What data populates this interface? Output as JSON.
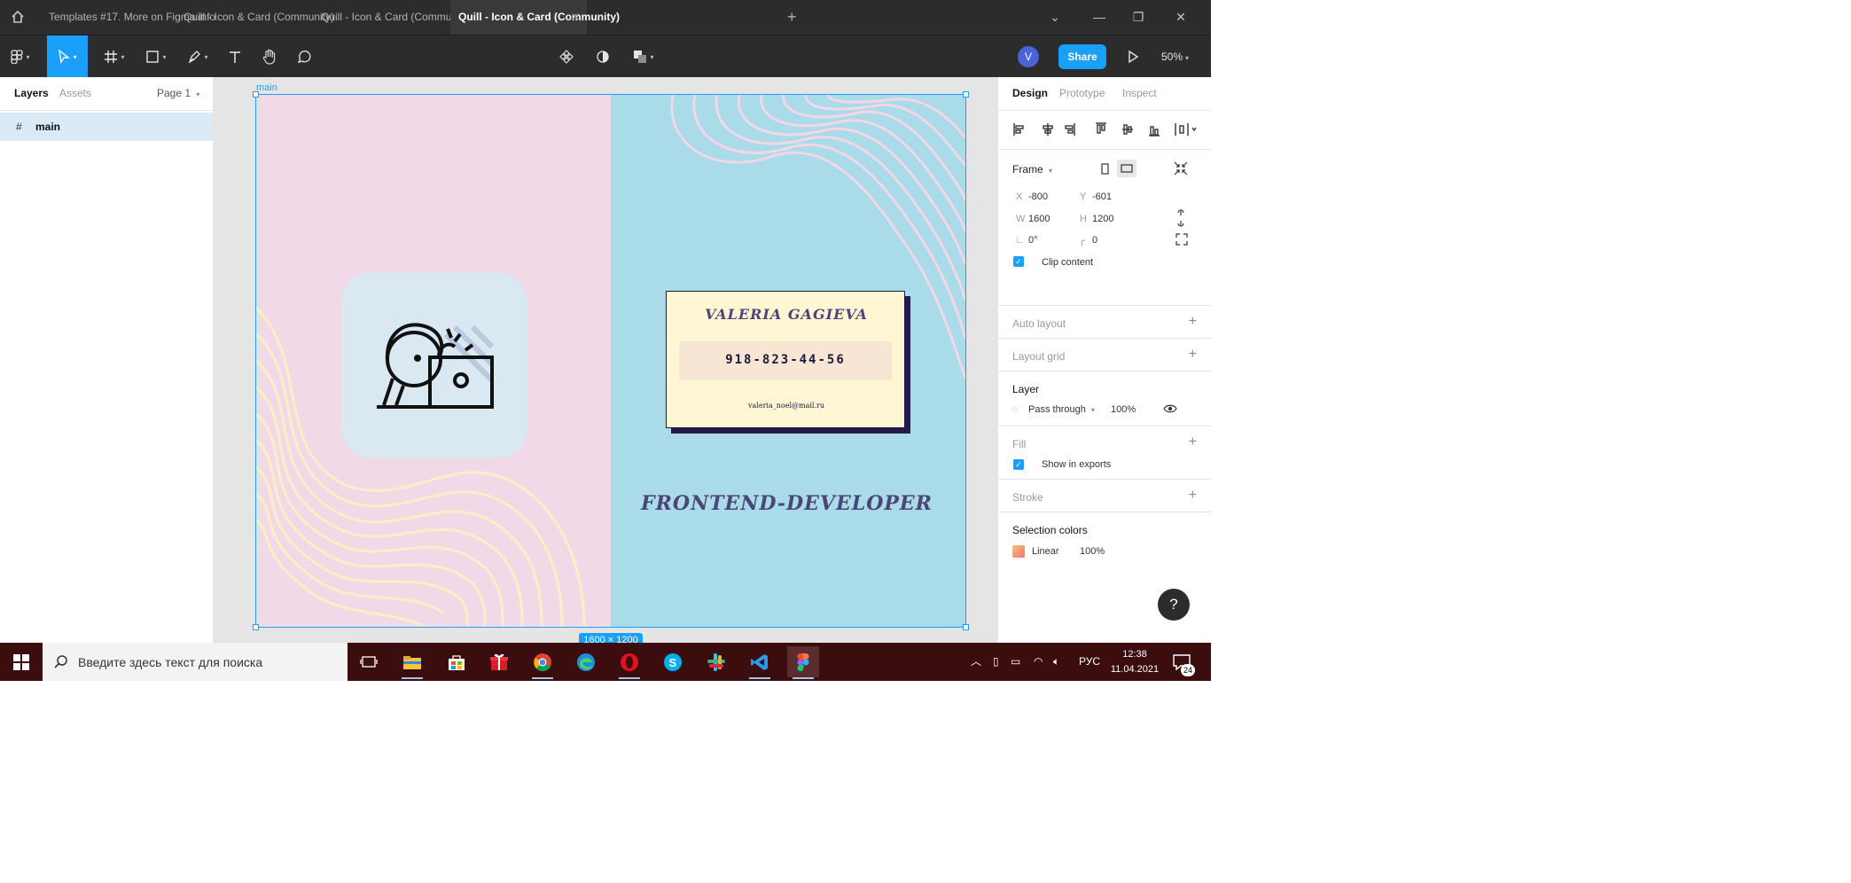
{
  "tabs": [
    {
      "label": "Templates #17. More on Figma.info",
      "active": false
    },
    {
      "label": "Quill - Icon & Card (Community)",
      "active": false
    },
    {
      "label": "Quill - Icon & Card (Community)",
      "active": false
    },
    {
      "label": "Quill - Icon & Card (Community)",
      "active": true
    }
  ],
  "tab_close": "✕",
  "new_tab": "+",
  "toolbar": {
    "avatar_initial": "V",
    "share_label": "Share",
    "zoom": "50%"
  },
  "left_panel": {
    "tabs": [
      "Layers",
      "Assets"
    ],
    "page": "Page 1",
    "layers": [
      {
        "name": "main",
        "icon": "frame-hash-icon"
      }
    ]
  },
  "canvas": {
    "frame_label": "main",
    "size_label": "1600 × 1200",
    "card": {
      "name": "VALERIA GAGIEVA",
      "phone": "918-823-44-56",
      "email": "valeria_noel@mail.ru"
    },
    "role": "FRONTEND-DEVELOPER",
    "colors": {
      "pink": "#f3d9e7",
      "blue": "#a9dbe8",
      "card": "#fff6d4",
      "shadow": "#241b4d"
    }
  },
  "right_panel": {
    "tabs": [
      "Design",
      "Prototype",
      "Inspect"
    ],
    "frame_title": "Frame",
    "x_label": "X",
    "x": "-800",
    "y_label": "Y",
    "y": "-601",
    "w_label": "W",
    "w": "1600",
    "h_label": "H",
    "h": "1200",
    "rotation": "0°",
    "radius": "0",
    "clip_content": "Clip content",
    "auto_layout": "Auto layout",
    "layout_grid": "Layout grid",
    "layer_title": "Layer",
    "blend": "Pass through",
    "opacity": "100%",
    "fill_title": "Fill",
    "show_in_exports": "Show in exports",
    "stroke_title": "Stroke",
    "selection_colors": "Selection colors",
    "sel_color_type": "Linear",
    "sel_color_opacity": "100%",
    "help": "?"
  },
  "taskbar": {
    "search_placeholder": "Введите здесь текст для поиска",
    "lang": "РУС",
    "time": "12:38",
    "date": "11.04.2021",
    "notifications": "24"
  }
}
